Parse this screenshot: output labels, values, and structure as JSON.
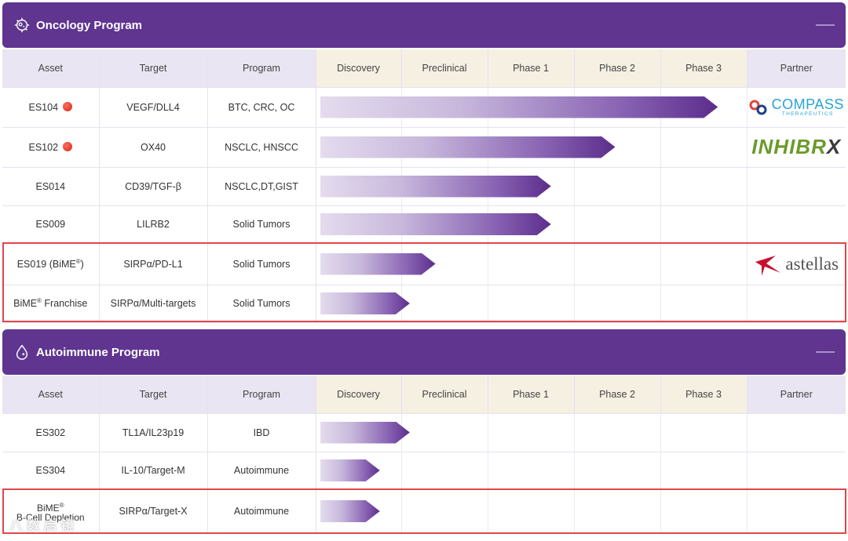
{
  "oncology": {
    "title": "Oncology Program",
    "headers": [
      "Asset",
      "Target",
      "Program",
      "Discovery",
      "Preclinical",
      "Phase 1",
      "Phase 2",
      "Phase 3",
      "Partner"
    ],
    "rows": [
      {
        "asset": "ES104",
        "dot": true,
        "target": "VEGF/DLL4",
        "program": "BTC, CRC, OC",
        "stage_reached": 4.7,
        "partner": "compass"
      },
      {
        "asset": "ES102",
        "dot": true,
        "target": "OX40",
        "program": "NSCLC, HNSCC",
        "stage_reached": 3.5,
        "partner": "inhibrx"
      },
      {
        "asset": "ES014",
        "dot": false,
        "target": "CD39/TGF-β",
        "program": "NSCLC,DT,GIST",
        "stage_reached": 2.75,
        "partner": ""
      },
      {
        "asset": "ES009",
        "dot": false,
        "target": "LILRB2",
        "program": "Solid Tumors",
        "stage_reached": 2.75,
        "partner": ""
      },
      {
        "asset": "ES019 (BiME",
        "asset_sup": "®",
        "asset_tail": ")",
        "dot": false,
        "target": "SIRPα/PD-L1",
        "program": "Solid Tumors",
        "stage_reached": 1.4,
        "partner": "astellas"
      },
      {
        "asset": "BiME",
        "asset_sup": "®",
        "asset_tail": " Franchise",
        "dot": false,
        "target": "SIRPα/Multi-targets",
        "program": "Solid Tumors",
        "stage_reached": 1.1,
        "partner": ""
      }
    ]
  },
  "autoimmune": {
    "title": "Autoimmune Program",
    "headers": [
      "Asset",
      "Target",
      "Program",
      "Discovery",
      "Preclinical",
      "Phase 1",
      "Phase 2",
      "Phase 3",
      "Partner"
    ],
    "rows": [
      {
        "asset": "ES302",
        "target": "TL1A/IL23p19",
        "program": "IBD",
        "stage_reached": 1.1
      },
      {
        "asset": "ES304",
        "target": "IL-10/Target-M",
        "program": "Autoimmune",
        "stage_reached": 0.75
      },
      {
        "asset": "BiME",
        "asset_sup": "®",
        "asset_line2": "B-Cell Depletion",
        "target": "SIRPα/Target-X",
        "program": "Autoimmune",
        "stage_reached": 0.75
      }
    ]
  },
  "partners": {
    "compass": {
      "name": "COMPASS",
      "sub": "THERAPEUTICS"
    },
    "inhibrx": {
      "name": "INHIBR",
      "tail": "X"
    },
    "astellas": {
      "name": "astellas"
    }
  },
  "watermark": "八 数 启 镜",
  "colors": {
    "header": "#5f3590",
    "highlight": "#e0464a",
    "bar_end": "#5b2d8c"
  }
}
